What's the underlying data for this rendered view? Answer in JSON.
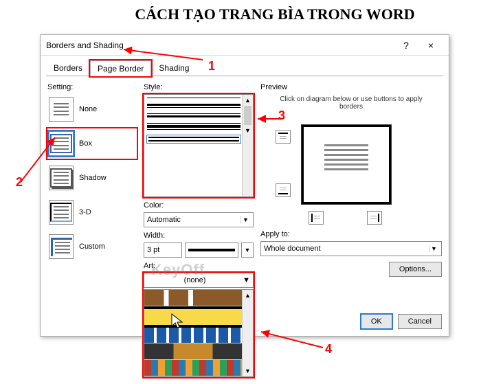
{
  "page_title": "CÁCH TẠO TRANG BÌA TRONG WORD",
  "dialog": {
    "title": "Borders and Shading",
    "help_icon": "?",
    "close_icon": "×"
  },
  "tabs": {
    "borders": "Borders",
    "page_border": "Page Border",
    "shading": "Shading"
  },
  "setting": {
    "label": "Setting:",
    "none": "None",
    "box": "Box",
    "shadow": "Shadow",
    "threed": "3-D",
    "custom": "Custom"
  },
  "style": {
    "label": "Style:",
    "color_label": "Color:",
    "color_value": "Automatic",
    "width_label": "Width:",
    "width_value": "3 pt",
    "art_label": "Art:",
    "art_value": "(none)"
  },
  "preview": {
    "label": "Preview",
    "hint": "Click on diagram below or use buttons to apply borders",
    "apply_label": "Apply to:",
    "apply_value": "Whole document",
    "options": "Options..."
  },
  "buttons": {
    "ok": "OK",
    "cancel": "Cancel"
  },
  "annotations": {
    "n1": "1",
    "n2": "2",
    "n3": "3",
    "n4": "4"
  },
  "watermark": "KeyOff"
}
